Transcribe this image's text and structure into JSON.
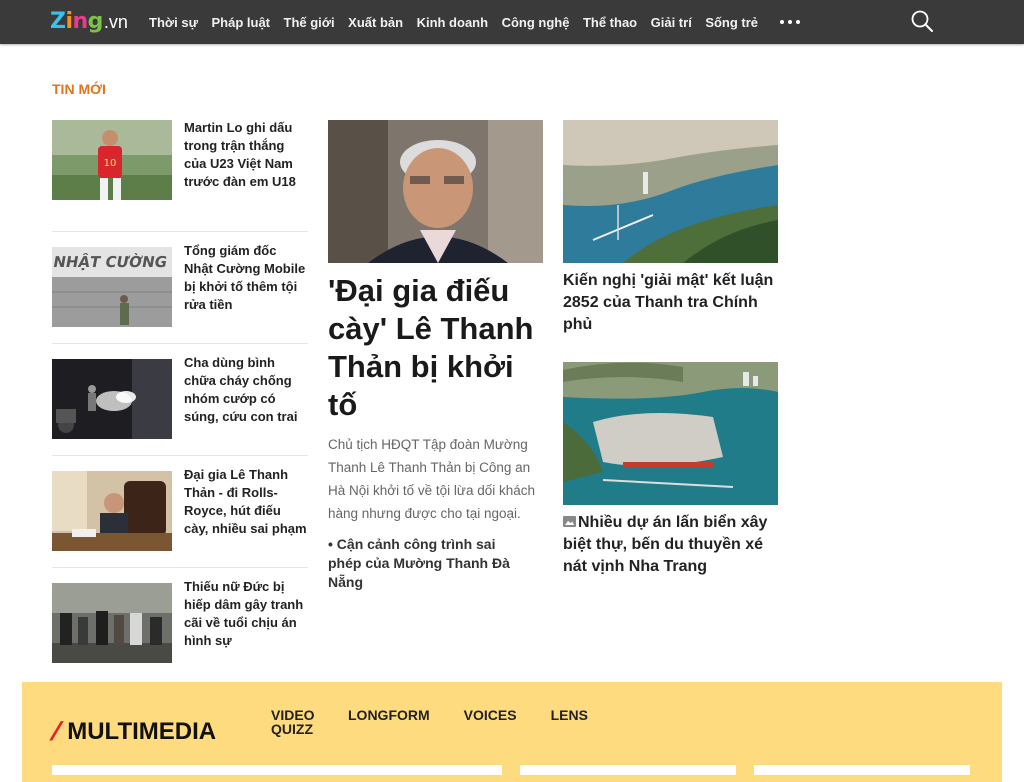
{
  "brand": {
    "logo_letters": [
      "Z",
      "i",
      "n",
      "g"
    ],
    "logo_suffix": ".vn"
  },
  "nav": {
    "items": [
      "Thời sự",
      "Pháp luật",
      "Thế giới",
      "Xuất bản",
      "Kinh doanh",
      "Công nghệ",
      "Thể thao",
      "Giải trí",
      "Sống trẻ"
    ],
    "more_icon": "more-dots-icon",
    "search_icon": "search-icon"
  },
  "section_label": "TIN MỚI",
  "news_list": [
    {
      "title": "Martin Lo ghi dấu trong trận thắng của U23 Việt Nam trước đàn em U18"
    },
    {
      "title": "Tổng giám đốc Nhật Cường Mobile bị khởi tố thêm tội rửa tiền"
    },
    {
      "title": "Cha dùng bình chữa cháy chống nhóm cướp có súng, cứu con trai"
    },
    {
      "title": "Đại gia Lê Thanh Thản - đi Rolls-Royce, hút điếu cày, nhiều sai phạm"
    },
    {
      "title": "Thiếu nữ Đức bị hiếp dâm gây tranh cãi về tuổi chịu án hình sự"
    }
  ],
  "feature": {
    "title": "'Đại gia điếu cày' Lê Thanh Thản bị khởi tố",
    "description": "Chủ tịch HĐQT Tập đoàn Mường Thanh Lê Thanh Thản bị Công an Hà Nội khởi tố về tội lừa dối khách hàng nhưng được cho tại ngoại.",
    "related_bullet": "•",
    "related": "Cận cảnh công trình sai phép của Mường Thanh Đà Nẵng"
  },
  "side_stories": [
    {
      "title": "Kiến nghị 'giải mật' kết luận 2852 của Thanh tra Chính phủ"
    },
    {
      "title": "Nhiều dự án lấn biển xây biệt thự, bến du thuyền xé nát vịnh Nha Trang",
      "icon": "photo-icon"
    }
  ],
  "multimedia": {
    "slash": "/",
    "title": "MULTIMEDIA",
    "tabs": [
      "VIDEO QUIZZ",
      "LONGFORM",
      "VOICES",
      "LENS"
    ],
    "background": "#fedb7e"
  },
  "colors": {
    "topbar": "#3a3a3a",
    "section_label": "#e5731e",
    "multimedia_accent": "#e8222c"
  }
}
